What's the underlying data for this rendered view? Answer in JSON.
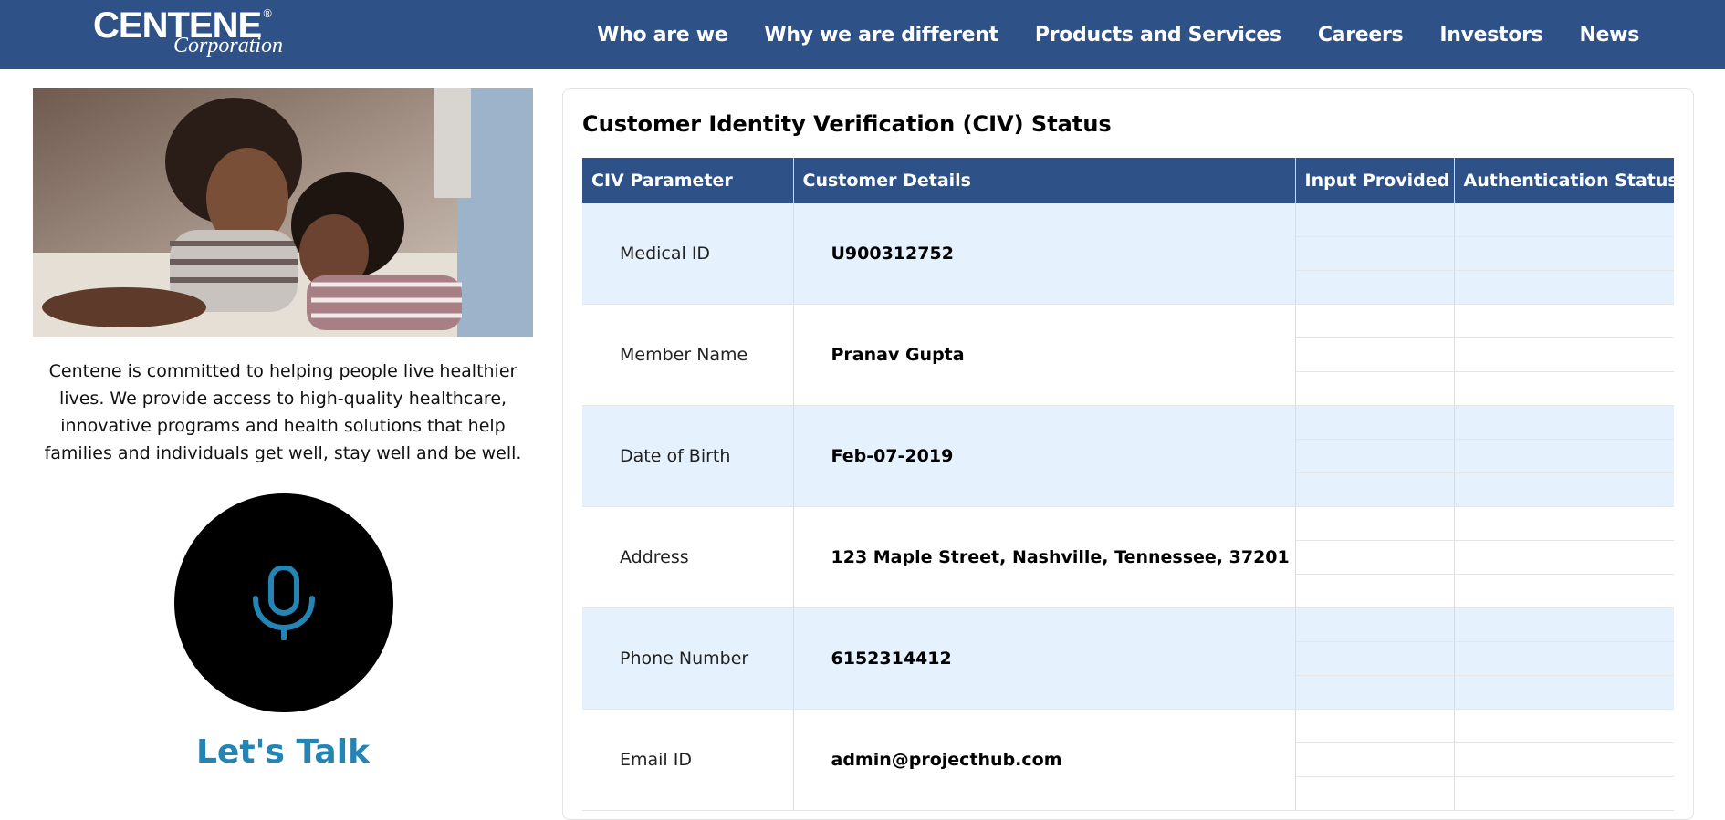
{
  "header": {
    "logo_brand": "CENTENE",
    "logo_reg": "®",
    "logo_sub": "Corporation",
    "nav": [
      "Who are we",
      "Why we are different",
      "Products and Services",
      "Careers",
      "Investors",
      "News"
    ]
  },
  "left": {
    "hero_alt": "mother-and-child-photo",
    "intro": "Centene is committed to helping people live healthier lives. We provide access to high-quality healthcare, innovative programs and health solutions that help families and individuals get well, stay well and be well.",
    "mic_icon": "microphone-icon",
    "lets_talk": "Let's Talk"
  },
  "civ": {
    "title": "Customer Identity Verification (CIV) Status",
    "columns": [
      "CIV Parameter",
      "Customer Details",
      "Input Provided",
      "Authentication Status"
    ],
    "rows": [
      {
        "param": "Medical ID",
        "detail": "U900312752",
        "input": "",
        "status": ""
      },
      {
        "param": "Member Name",
        "detail": "Pranav Gupta",
        "input": "",
        "status": ""
      },
      {
        "param": "Date of Birth",
        "detail": "Feb-07-2019",
        "input": "",
        "status": ""
      },
      {
        "param": "Address",
        "detail": "123 Maple Street, Nashville, Tennessee, 37201",
        "input": "",
        "status": ""
      },
      {
        "param": "Phone Number",
        "detail": "6152314412",
        "input": "",
        "status": ""
      },
      {
        "param": "Email ID",
        "detail": "admin@projecthub.com",
        "input": "",
        "status": ""
      }
    ]
  },
  "colors": {
    "header_bg": "#2e5287",
    "row_shade": "#e5f1fd",
    "accent": "#2484b4"
  }
}
